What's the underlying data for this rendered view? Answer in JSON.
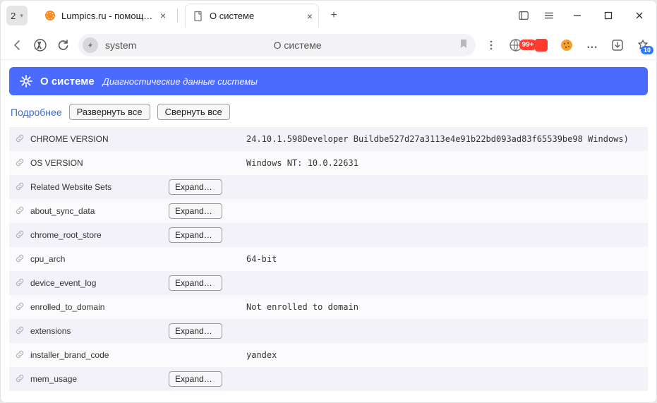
{
  "window": {
    "tab_count": "2",
    "tabs": [
      {
        "label": "Lumpics.ru - помощь с",
        "icon": "orange-circle"
      },
      {
        "label": "О системе",
        "icon": "page"
      }
    ],
    "newtab_tooltip": "+"
  },
  "addressbar": {
    "domain": "system",
    "title": "О системе",
    "notif_count": "10",
    "ext_badge": "99+"
  },
  "page_header": {
    "title": "О системе",
    "subtitle": "Диагностические данные системы"
  },
  "toolbar": {
    "details_link": "Подробнее",
    "expand_all": "Развернуть все",
    "collapse_all": "Свернуть все",
    "expand_btn": "Expand…"
  },
  "rows": [
    {
      "key": "CHROME VERSION",
      "expand": false,
      "value": "24.10.1.598Developer Buildbe527d27a3113e4e91b22bd093ad83f65539be98 Windows)"
    },
    {
      "key": "OS VERSION",
      "expand": false,
      "value": "Windows NT: 10.0.22631"
    },
    {
      "key": "Related Website Sets",
      "expand": true,
      "value": ""
    },
    {
      "key": "about_sync_data",
      "expand": true,
      "value": ""
    },
    {
      "key": "chrome_root_store",
      "expand": true,
      "value": ""
    },
    {
      "key": "cpu_arch",
      "expand": false,
      "value": "64-bit"
    },
    {
      "key": "device_event_log",
      "expand": true,
      "value": ""
    },
    {
      "key": "enrolled_to_domain",
      "expand": false,
      "value": "Not enrolled to domain"
    },
    {
      "key": "extensions",
      "expand": true,
      "value": ""
    },
    {
      "key": "installer_brand_code",
      "expand": false,
      "value": "yandex"
    },
    {
      "key": "mem_usage",
      "expand": true,
      "value": ""
    }
  ]
}
